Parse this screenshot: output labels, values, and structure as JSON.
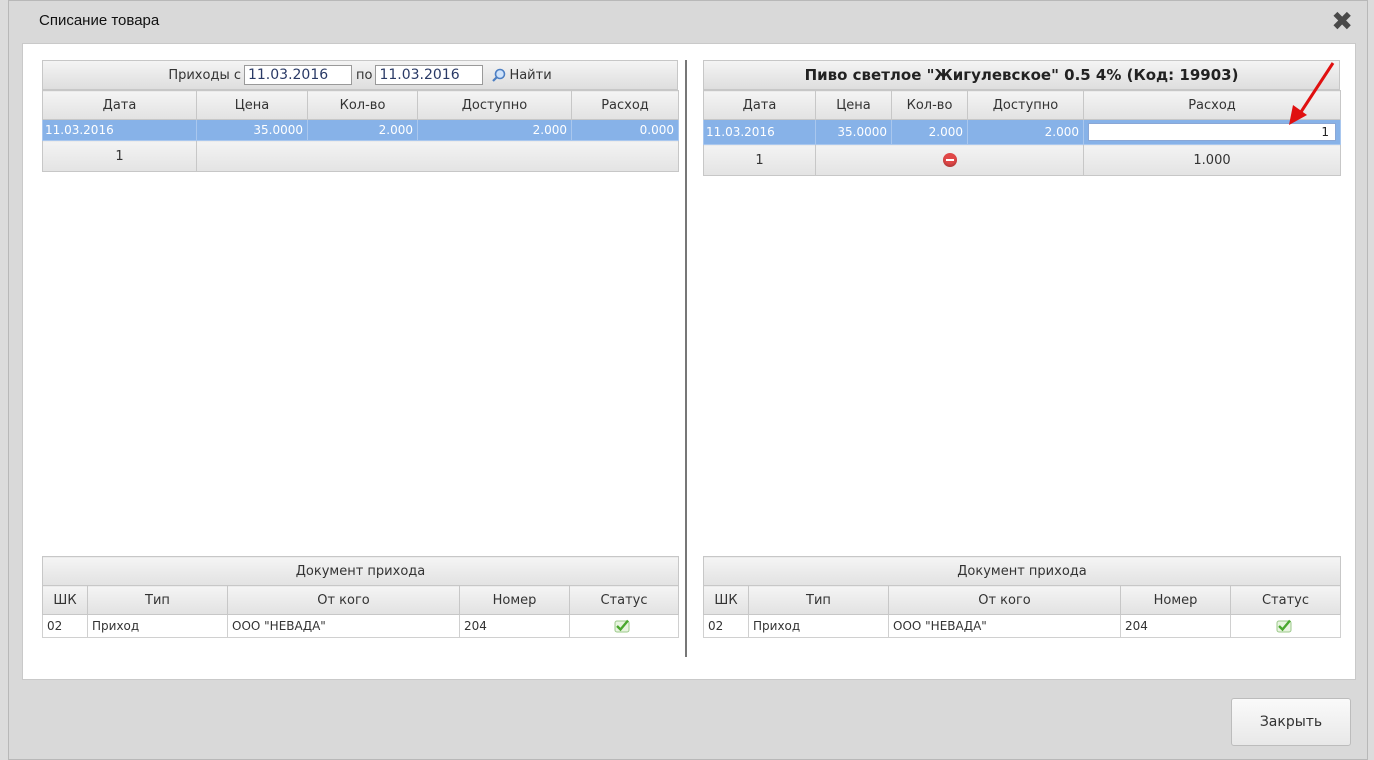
{
  "dialog": {
    "title": "Списание товара",
    "close_label": "Закрыть"
  },
  "left": {
    "filter": {
      "from_label": "Приходы с",
      "date_from": "11.03.2016",
      "to_label": "по",
      "date_to": "11.03.2016",
      "find_label": "Найти"
    },
    "columns": [
      "Дата",
      "Цена",
      "Кол-во",
      "Доступно",
      "Расход"
    ],
    "rows": [
      {
        "date": "11.03.2016",
        "price": "35.0000",
        "qty": "2.000",
        "available": "2.000",
        "expense": "0.000"
      }
    ],
    "total_count": "1",
    "doc": {
      "title": "Документ прихода",
      "columns": [
        "ШК",
        "Тип",
        "От кого",
        "Номер",
        "Статус"
      ],
      "row": {
        "code": "02",
        "type": "Приход",
        "from": "ООО \"НЕВАДА\"",
        "number": "204",
        "status_icon": "check-icon"
      }
    }
  },
  "right": {
    "title": "Пиво светлое \"Жигулевское\" 0.5 4% (Код: 19903)",
    "columns": [
      "Дата",
      "Цена",
      "Кол-во",
      "Доступно",
      "Расход"
    ],
    "rows": [
      {
        "date": "11.03.2016",
        "price": "35.0000",
        "qty": "2.000",
        "available": "2.000",
        "expense_input": "1"
      }
    ],
    "total_count": "1",
    "total_expense": "1.000",
    "doc": {
      "title": "Документ прихода",
      "columns": [
        "ШК",
        "Тип",
        "От кого",
        "Номер",
        "Статус"
      ],
      "row": {
        "code": "02",
        "type": "Приход",
        "from": "ООО \"НЕВАДА\"",
        "number": "204",
        "status_icon": "check-icon"
      }
    }
  },
  "colors": {
    "selection": "#87b2e8",
    "remove": "#e04848",
    "arrow": "#e01010",
    "check": "#5cb83a"
  }
}
